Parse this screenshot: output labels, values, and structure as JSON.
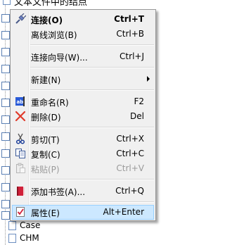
{
  "background_tree": {
    "top_label": "文本文件中的结点",
    "rows": [
      {
        "label": "Case"
      },
      {
        "label": "CHM"
      }
    ]
  },
  "context_menu": {
    "items": [
      {
        "id": "connect",
        "label": "连接(O)",
        "shortcut": "Ctrl+T",
        "icon": "connect-plug-icon",
        "bold": true
      },
      {
        "id": "offline",
        "label": "离线浏览(B)",
        "shortcut": "Ctrl+B",
        "icon": null
      },
      {
        "id": "wizard",
        "label": "连接向导(W)...",
        "shortcut": "Ctrl+J",
        "icon": null
      },
      {
        "id": "new",
        "label": "新建(N)",
        "shortcut": "",
        "icon": null,
        "submenu": true
      },
      {
        "id": "rename",
        "label": "重命名(R)",
        "shortcut": "F2",
        "icon": "rename-icon"
      },
      {
        "id": "delete",
        "label": "删除(D)",
        "shortcut": "Del",
        "icon": "delete-x-icon"
      },
      {
        "id": "cut",
        "label": "剪切(T)",
        "shortcut": "Ctrl+X",
        "icon": "scissors-icon"
      },
      {
        "id": "copy",
        "label": "复制(C)",
        "shortcut": "Ctrl+C",
        "icon": "copy-icon"
      },
      {
        "id": "paste",
        "label": "粘贴(P)",
        "shortcut": "Ctrl+V",
        "icon": "paste-icon",
        "disabled": true
      },
      {
        "id": "bookmark",
        "label": "添加书签(A)...",
        "shortcut": "Ctrl+Q",
        "icon": "bookmark-book-icon"
      },
      {
        "id": "properties",
        "label": "属性(E)",
        "shortcut": "Alt+Enter",
        "icon": "properties-checklist-icon",
        "highlighted": true
      }
    ]
  },
  "colors": {
    "menu_bg": "#f0f0f0",
    "highlight_bg": "#cce8ff",
    "highlight_border": "#99d1ff",
    "disabled_text": "#9a9a9a"
  }
}
